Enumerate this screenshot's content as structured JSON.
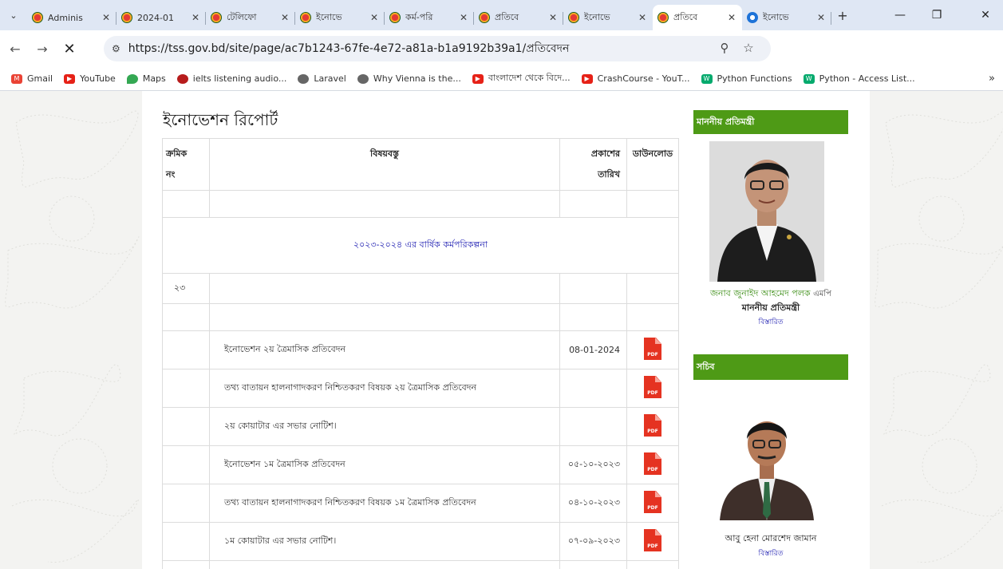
{
  "browser": {
    "tabs": [
      {
        "title": "Adminis",
        "active": false
      },
      {
        "title": "2024-01",
        "active": false
      },
      {
        "title": "টেলিফো",
        "active": false
      },
      {
        "title": "ইনোভে",
        "active": false
      },
      {
        "title": "কর্ম-পরি",
        "active": false
      },
      {
        "title": "প্রতিবে",
        "active": false
      },
      {
        "title": "ইনোভে",
        "active": false
      },
      {
        "title": "প্রতিবে",
        "active": true
      },
      {
        "title": "ইনোভে",
        "active": false
      }
    ],
    "url": "https://tss.gov.bd/site/page/ac7b1243-67fe-4e72-a81a-b1a9192b39a1/প্রতিবেদন",
    "bookmarks": [
      {
        "label": "Gmail",
        "icon": "gmail-icon",
        "color": "#EA4335"
      },
      {
        "label": "YouTube",
        "icon": "youtube-icon",
        "color": "#E62117"
      },
      {
        "label": "Maps",
        "icon": "maps-icon",
        "color": "#34A853"
      },
      {
        "label": "ielts listening audio...",
        "icon": "record-icon",
        "color": "#B71C1C"
      },
      {
        "label": "Laravel",
        "icon": "globe-icon",
        "color": "#555555"
      },
      {
        "label": "Why Vienna is the...",
        "icon": "globe-icon",
        "color": "#555555"
      },
      {
        "label": "বাংলাদেশ থেকে বিদে...",
        "icon": "youtube-icon",
        "color": "#E62117"
      },
      {
        "label": "CrashCourse - YouT...",
        "icon": "youtube-icon",
        "color": "#E62117"
      },
      {
        "label": "Python Functions",
        "icon": "w3schools-icon",
        "color": "#04AA6D"
      },
      {
        "label": "Python - Access List...",
        "icon": "w3schools-icon",
        "color": "#04AA6D"
      }
    ],
    "bookmarks_more": "»"
  },
  "page": {
    "title": "ইনোভেশন রিপোর্ট",
    "table": {
      "headers": {
        "serial_line1": "ক্রমিক",
        "serial_line2": "নং",
        "subject": "বিষয়বস্তু",
        "date_line1": "প্রকাশের",
        "date_line2": "তারিখ",
        "download": "ডাউনলোড"
      },
      "section_title": "২০২৩-২০২৪ এর বার্ষিক কর্মপরিকল্পনা",
      "serial_number": "২৩",
      "rows": [
        {
          "subject": "ইনোভেশন ২য় ত্রৈমাসিক প্রতিবেদন",
          "date": "08-01-2024"
        },
        {
          "subject": "তথ্য বাতায়ন হালনাগাদকরণ নিশ্চিতকরণ বিষয়ক ২য় ত্রৈমাসিক প্রতিবেদন",
          "date": ""
        },
        {
          "subject": "২য় কোয়াটার এর সভার নোটিশ।",
          "date": ""
        },
        {
          "subject": "ইনোভেশন ১ম ত্রৈমাসিক প্রতিবেদন",
          "date": "০৫-১০-২০২৩"
        },
        {
          "subject": "তথ্য বাতায়ন হালনাগাদকরণ নিশ্চিতকরণ বিষয়ক ১ম ত্রৈমাসিক প্রতিবেদন",
          "date": "০৪-১০-২০২৩"
        },
        {
          "subject": "১ম কোয়াটার এর সভার নোটিশ।",
          "date": "০৭-০৯-২০২৩"
        }
      ],
      "pdf_label": "PDF"
    },
    "sidebar": {
      "minister_heading": "মাননীয় প্রতিমন্ত্রী",
      "minister_name": "জনাব জুনাইদ আহমেদ পলক",
      "minister_suffix": "এমপি",
      "minister_title": "মাননীয় প্রতিমন্ত্রী",
      "minister_detail": "বিস্তারিত",
      "secretary_heading": "সচিব",
      "secretary_name": "আবু হেনা মোরশেদ জামান",
      "secretary_detail": "বিস্তারিত"
    },
    "colors": {
      "accent_green": "#4e9a16",
      "link_blue": "#1a1ab0",
      "pdf_red": "#e53321"
    }
  }
}
